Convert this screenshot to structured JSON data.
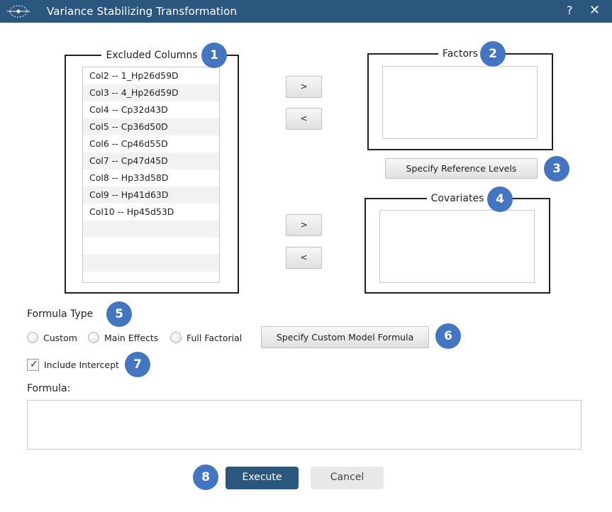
{
  "window": {
    "title": "Variance Stabilizing Transformation",
    "help_symbol": "?",
    "close_symbol": "✕",
    "titlebar_color": "#2b577f"
  },
  "excluded_columns": {
    "legend": "Excluded Columns",
    "items": [
      "Col2 -- 1_Hp26d59D",
      "Col3 -- 4_Hp26d59D",
      "Col4 -- Cp32d43D",
      "Col5 -- Cp36d50D",
      "Col6 -- Cp46d55D",
      "Col7 -- Cp47d45D",
      "Col8 -- Hp33d58D",
      "Col9 -- Hp41d63D",
      "Col10 -- Hp45d53D"
    ],
    "border_color": "#f5b36a"
  },
  "factors": {
    "legend": "Factors",
    "border_color": "#5cc8ea"
  },
  "covariates": {
    "legend": "Covariates",
    "border_color": "#5cc8ea"
  },
  "buttons": {
    "add_factor": ">",
    "remove_factor": "<",
    "add_covariate": ">",
    "remove_covariate": "<",
    "specify_reference_levels": "Specify Reference Levels",
    "specify_custom_model_formula": "Specify Custom Model Formula",
    "execute": "Execute",
    "cancel": "Cancel"
  },
  "formula_type": {
    "label": "Formula Type",
    "options": [
      "Custom",
      "Main Effects",
      "Full Factorial"
    ]
  },
  "include_intercept": {
    "label": "Include Intercept",
    "checked": true,
    "check_symbol": "✓"
  },
  "formula": {
    "label": "Formula:",
    "value": ""
  },
  "badges": [
    "1",
    "2",
    "3",
    "4",
    "5",
    "6",
    "7",
    "8"
  ],
  "badge_color": "#4475c0"
}
